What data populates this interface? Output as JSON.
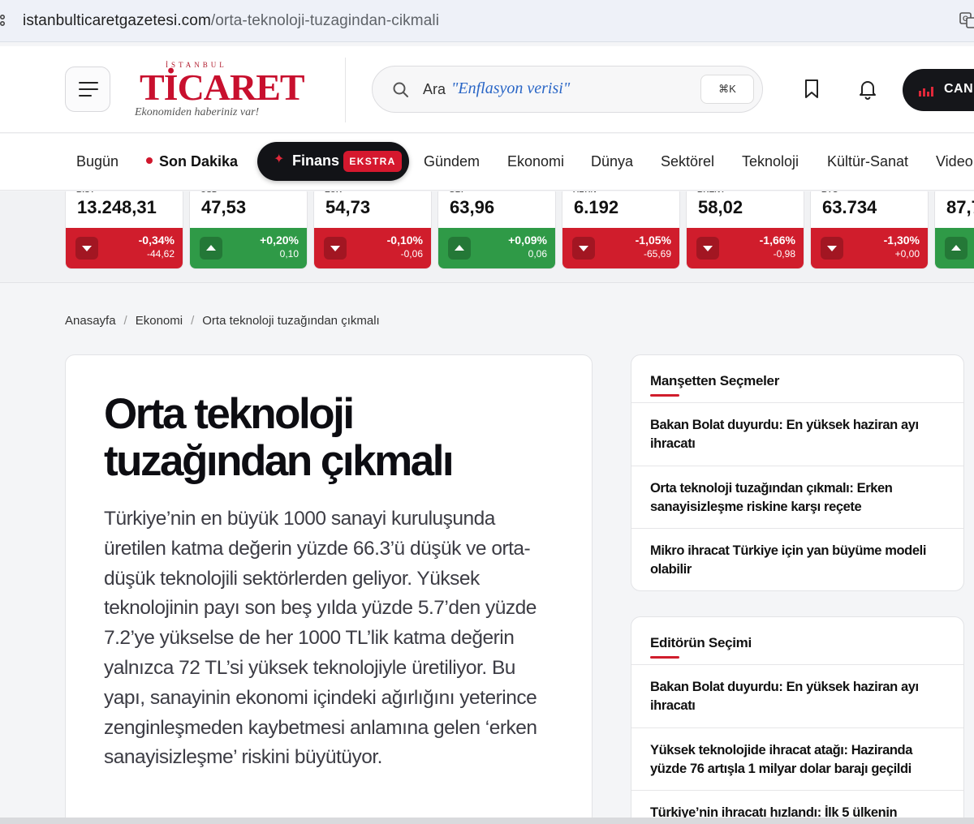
{
  "browser": {
    "url_host": "istanbulticaretgazetesi.com",
    "url_path": "/orta-teknoloji-tuzagindan-cikmali"
  },
  "header": {
    "logo_top": "İSTANBUL",
    "logo_main": "TİCARET",
    "logo_tagline": "Ekonomiden haberiniz var!",
    "search_label": "Ara",
    "search_hint": "\"Enflasyon verisi\"",
    "search_shortcut": "⌘K",
    "live_label": "CAN"
  },
  "nav": {
    "items": [
      "Bugün",
      "Son Dakika",
      "Finans",
      "Gündem",
      "Ekonomi",
      "Dünya",
      "Sektörel",
      "Teknoloji",
      "Kültür-Sanat",
      "Video"
    ],
    "finans_badge": "EKSTRA"
  },
  "ticker": [
    {
      "name": "BIST",
      "value": "13.248,31",
      "pct": "-0,34%",
      "abs": "-44,62",
      "dir": "down"
    },
    {
      "name": "USD",
      "value": "47,53",
      "pct": "+0,20%",
      "abs": "0,10",
      "dir": "up"
    },
    {
      "name": "EUR",
      "value": "54,73",
      "pct": "-0,10%",
      "abs": "-0,06",
      "dir": "down"
    },
    {
      "name": "GBP",
      "value": "63,96",
      "pct": "+0,09%",
      "abs": "0,06",
      "dir": "up"
    },
    {
      "name": "ALTIN",
      "value": "6.192",
      "pct": "-1,05%",
      "abs": "-65,69",
      "dir": "down"
    },
    {
      "name": "BRENT",
      "value": "58,02",
      "pct": "-1,66%",
      "abs": "-0,98",
      "dir": "down"
    },
    {
      "name": "BTC",
      "value": "63.734",
      "pct": "-1,30%",
      "abs": "+0,00",
      "dir": "down"
    },
    {
      "name": "",
      "value": "87,7",
      "pct": "",
      "abs": "",
      "dir": "up"
    }
  ],
  "breadcrumb": {
    "items": [
      "Anasayfa",
      "Ekonomi",
      "Orta teknoloji tuzağından çıkmalı"
    ],
    "sep": "/"
  },
  "article": {
    "title": "Orta teknoloji tuzağından çıkmalı",
    "lead": "Türkiye’nin en büyük 1000 sanayi kuruluşunda üretilen katma değerin yüzde 66.3’ü düşük ve orta-düşük teknolojili sektörlerden geliyor. Yüksek teknolojinin payı son beş yılda yüzde 5.7’den yüzde 7.2’ye yükselse de her 1000 TL’lik katma değerin yalnızca 72 TL’si yüksek teknolojiyle üretiliyor. Bu yapı, sanayinin ekonomi içindeki ağırlığını yeterince zenginleşmeden kaybetmesi anlamına gelen ‘erken sanayisizleşme’ riskini büyütüyor."
  },
  "sidebar": {
    "manset": {
      "title": "Manşetten Seçmeler",
      "items": [
        "Bakan Bolat duyurdu: En yüksek haziran ayı ihracatı",
        "Orta teknoloji tuzağından çıkmalı: Erken sanayisizleşme riskine karşı reçete",
        "Mikro ihracat Türkiye için yan büyüme modeli olabilir"
      ]
    },
    "editor": {
      "title": "Editörün Seçimi",
      "items": [
        "Bakan Bolat duyurdu: En yüksek haziran ayı ihracatı",
        "Yüksek teknolojide ihracat atağı: Haziranda yüzde 76 artışla 1 milyar dolar barajı geçildi",
        "Türkiye’nin ihracatı hızlandı: İlk 5 ülkenin"
      ]
    }
  },
  "colors": {
    "brand_red": "#c8102e",
    "down": "#d01d2c",
    "up": "#2f9a47",
    "hint_blue": "#2a66c6"
  }
}
